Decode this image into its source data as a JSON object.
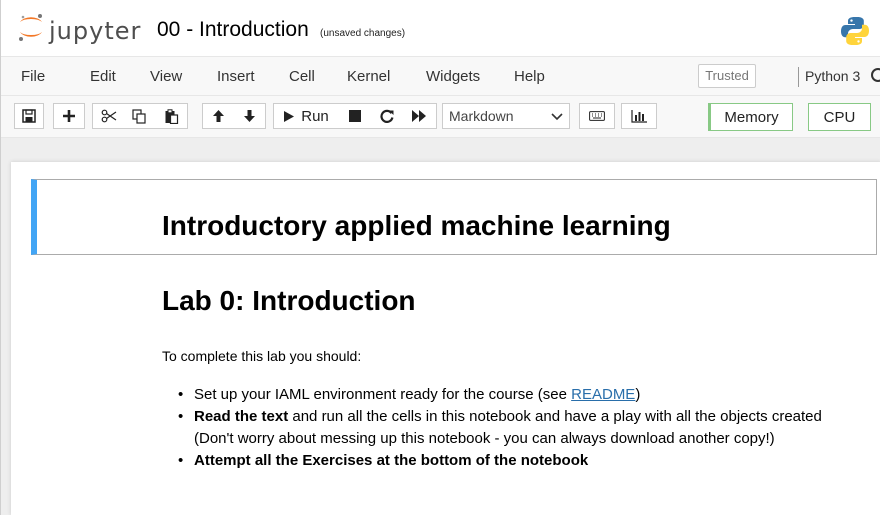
{
  "header": {
    "logo_text": "jupyter",
    "notebook_title": "00 - Introduction",
    "save_status": "(unsaved changes)"
  },
  "menu": {
    "items": [
      "File",
      "Edit",
      "View",
      "Insert",
      "Cell",
      "Kernel",
      "Widgets",
      "Help"
    ],
    "trusted": "Trusted",
    "kernel_name": "Python 3"
  },
  "toolbar": {
    "run_label": "Run",
    "cell_type": "Markdown",
    "memory_label": "Memory",
    "cpu_label": "CPU",
    "icons": [
      "save-icon",
      "plus-icon",
      "cut-icon",
      "copy-icon",
      "paste-icon",
      "arrow-up-icon",
      "arrow-down-icon",
      "play-icon",
      "stop-icon",
      "restart-icon",
      "fast-forward-icon",
      "keyboard-icon",
      "bar-chart-icon"
    ]
  },
  "notebook": {
    "cell1_heading": "Introductory applied machine learning",
    "cell2_heading": "Lab 0: Introduction",
    "intro": "To complete this lab you should:",
    "item1_text": "Set up your IAML environment ready for the course (see ",
    "item1_link": "README",
    "item1_end": ")",
    "item2_bold": "Read the text",
    "item2_text": " and run all the cells in this notebook and have a play with all the objects created (Don't worry about messing up this notebook - you can always download another copy!)",
    "item3_bold": "Attempt all the Exercises at the bottom of the notebook"
  },
  "colors": {
    "selected_cell_bar": "#42a5f5",
    "link": "#296eaa",
    "resource_border": "#88c985"
  }
}
